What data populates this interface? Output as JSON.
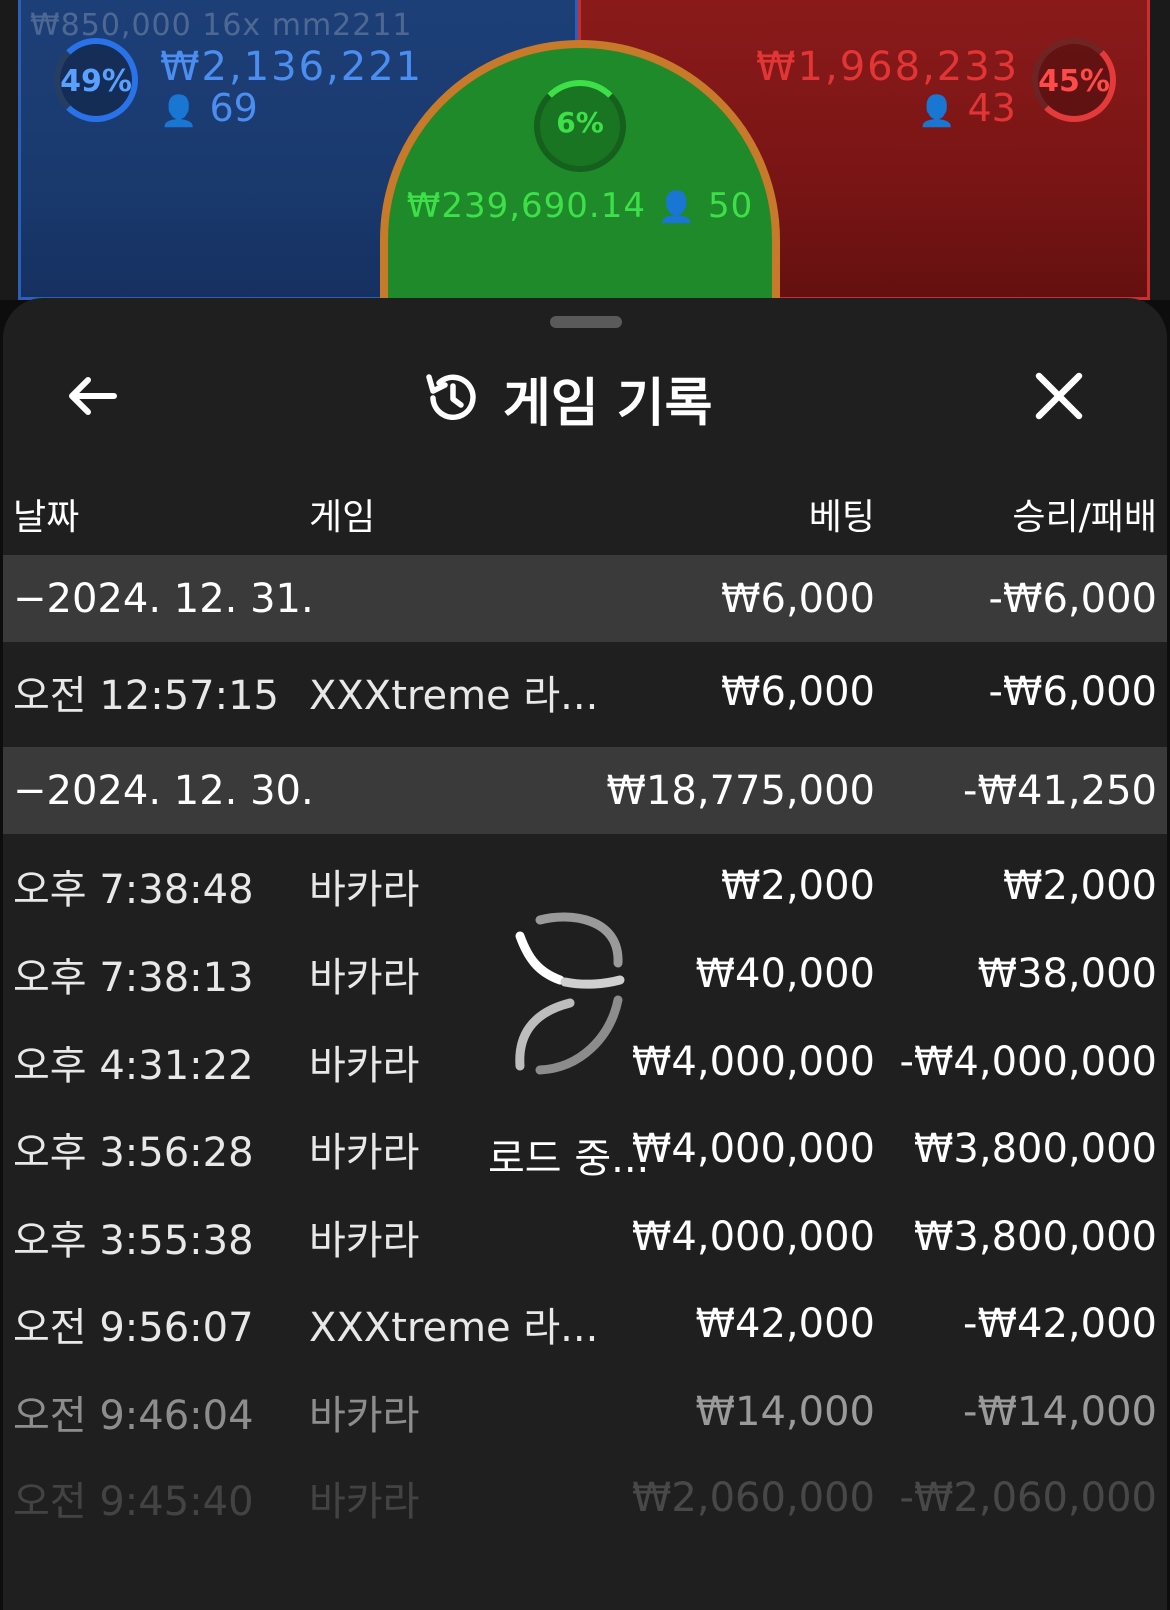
{
  "top": {
    "ghost_text": "₩850,000 16x mm2211",
    "blue": {
      "percent": "49%",
      "amount": "₩2,136,221",
      "players": "69",
      "color": "#2a72e8"
    },
    "green": {
      "percent": "6%",
      "amount": "₩239,690.14",
      "players": "50",
      "color": "#3ee04a"
    },
    "red": {
      "percent": "45%",
      "amount": "₩1,968,233",
      "players": "43",
      "color": "#e23535"
    }
  },
  "sheet": {
    "title": "게임 기록",
    "icons": {
      "back": "arrow-left-icon",
      "history": "history-icon",
      "close": "close-icon"
    },
    "columns": {
      "date": "날짜",
      "game": "게임",
      "bet": "베팅",
      "winloss": "승리/패배"
    },
    "rows": [
      {
        "kind": "group",
        "date": "−2024. 12. 31.",
        "game": "",
        "bet": "₩6,000",
        "winloss": "-₩6,000"
      },
      {
        "kind": "item",
        "date": "오전 12:57:15",
        "game": "XXXtreme 라...",
        "bet": "₩6,000",
        "winloss": "-₩6,000"
      },
      {
        "kind": "group",
        "date": "−2024. 12. 30.",
        "game": "",
        "bet": "₩18,775,000",
        "winloss": "-₩41,250"
      },
      {
        "kind": "item",
        "date": "오후 7:38:48",
        "game": "바카라",
        "bet": "₩2,000",
        "winloss": "₩2,000"
      },
      {
        "kind": "item",
        "date": "오후 7:38:13",
        "game": "바카라",
        "bet": "₩40,000",
        "winloss": "₩38,000"
      },
      {
        "kind": "item",
        "date": "오후 4:31:22",
        "game": "바카라",
        "bet": "₩4,000,000",
        "winloss": "-₩4,000,000"
      },
      {
        "kind": "item",
        "date": "오후 3:56:28",
        "game": "바카라",
        "bet": "₩4,000,000",
        "winloss": "₩3,800,000"
      },
      {
        "kind": "item",
        "date": "오후 3:55:38",
        "game": "바카라",
        "bet": "₩4,000,000",
        "winloss": "₩3,800,000"
      },
      {
        "kind": "item",
        "date": "오전 9:56:07",
        "game": "XXXtreme 라...",
        "bet": "₩42,000",
        "winloss": "-₩42,000"
      },
      {
        "kind": "item",
        "date": "오전 9:46:04",
        "game": "바카라",
        "bet": "₩14,000",
        "winloss": "-₩14,000"
      },
      {
        "kind": "item",
        "date": "오전 9:45:40",
        "game": "바카라",
        "bet": "₩2,060,000",
        "winloss": "-₩2,060,000"
      }
    ],
    "loading_text": "로드 중..."
  }
}
